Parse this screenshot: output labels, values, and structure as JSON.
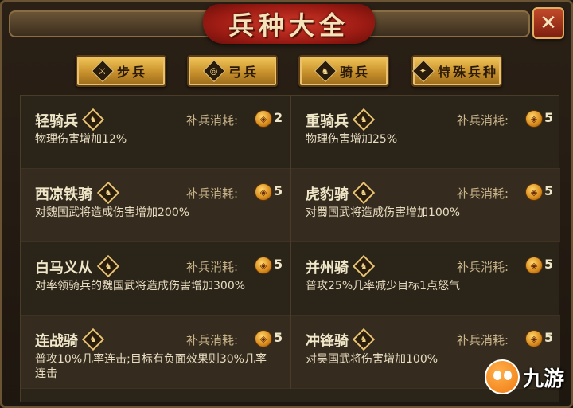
{
  "header": {
    "title": "兵种大全",
    "close_symbol": "✕"
  },
  "tabs": [
    {
      "label": "步兵",
      "icon": "boot-icon",
      "glyph": "⚔"
    },
    {
      "label": "弓兵",
      "icon": "bow-icon",
      "glyph": "◎"
    },
    {
      "label": "骑兵",
      "icon": "horse-icon",
      "glyph": "♞"
    },
    {
      "label": "特殊兵种",
      "icon": "star-icon",
      "glyph": "✦"
    }
  ],
  "units": [
    {
      "name": "轻骑兵",
      "cost_label": "补兵消耗:",
      "cost": "2",
      "desc": "物理伤害增加12%"
    },
    {
      "name": "重骑兵",
      "cost_label": "补兵消耗:",
      "cost": "5",
      "desc": "物理伤害增加25%"
    },
    {
      "name": "西凉铁骑",
      "cost_label": "补兵消耗:",
      "cost": "5",
      "desc": "对魏国武将造成伤害增加200%"
    },
    {
      "name": "虎豹骑",
      "cost_label": "补兵消耗:",
      "cost": "5",
      "desc": "对蜀国武将造成伤害增加100%"
    },
    {
      "name": "白马义从",
      "cost_label": "补兵消耗:",
      "cost": "5",
      "desc": "对率领骑兵的魏国武将造成伤害增加300%"
    },
    {
      "name": "并州骑",
      "cost_label": "补兵消耗:",
      "cost": "5",
      "desc": "普攻25%几率减少目标1点怒气"
    },
    {
      "name": "连战骑",
      "cost_label": "补兵消耗:",
      "cost": "5",
      "desc": "普攻10%几率连击;目标有负面效果则30%几率连击"
    },
    {
      "name": "冲锋骑",
      "cost_label": "补兵消耗:",
      "cost": "5",
      "desc": "对吴国武将伤害增加100%"
    }
  ],
  "unit_icon": {
    "name": "horse-icon",
    "glyph": "♞"
  },
  "coin_icon": {
    "name": "coin-icon",
    "glyph": "◈"
  },
  "watermark": {
    "text": "九游"
  },
  "colors": {
    "tab_gold": "#e0ac44",
    "title_red": "#b8231a",
    "text_light": "#f0e6c8"
  }
}
